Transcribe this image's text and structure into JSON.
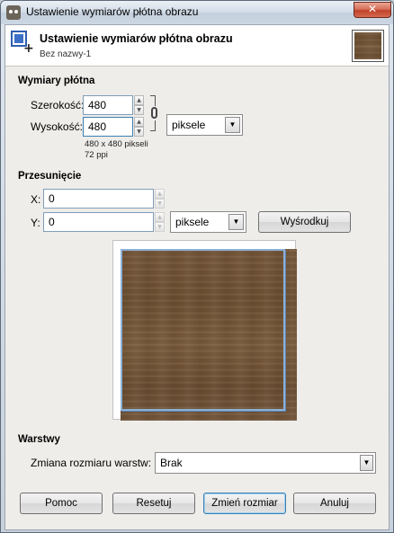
{
  "window": {
    "title": "Ustawienie wymiarów płótna obrazu",
    "close_label": "✕"
  },
  "header": {
    "title": "Ustawienie wymiarów płótna obrazu",
    "subtitle": "Bez nazwy-1"
  },
  "canvas_size": {
    "section_title": "Wymiary płótna",
    "width_label": "Szerokość:",
    "width_value": "480",
    "height_label": "Wysokość:",
    "height_value": "480",
    "unit": "piksele",
    "info_size": "480 x 480 pikseli",
    "info_res": "72 ppi"
  },
  "offset": {
    "section_title": "Przesunięcie",
    "x_label": "X:",
    "x_value": "0",
    "y_label": "Y:",
    "y_value": "0",
    "unit": "piksele",
    "center_button": "Wyśrodkuj"
  },
  "layers": {
    "section_title": "Warstwy",
    "resize_label": "Zmiana rozmiaru warstw:",
    "resize_value": "Brak"
  },
  "buttons": {
    "help": "Pomoc",
    "reset": "Resetuj",
    "resize": "Zmień rozmiar",
    "cancel": "Anuluj"
  },
  "colors": {
    "wood": "#6e5134",
    "accent": "#3c7fb1"
  }
}
